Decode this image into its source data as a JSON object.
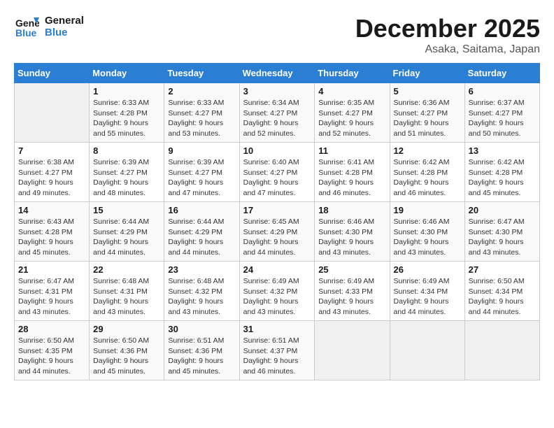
{
  "header": {
    "logo_line1": "General",
    "logo_line2": "Blue",
    "month_title": "December 2025",
    "location": "Asaka, Saitama, Japan"
  },
  "weekdays": [
    "Sunday",
    "Monday",
    "Tuesday",
    "Wednesday",
    "Thursday",
    "Friday",
    "Saturday"
  ],
  "weeks": [
    [
      {
        "day": "",
        "info": ""
      },
      {
        "day": "1",
        "info": "Sunrise: 6:33 AM\nSunset: 4:28 PM\nDaylight: 9 hours\nand 55 minutes."
      },
      {
        "day": "2",
        "info": "Sunrise: 6:33 AM\nSunset: 4:27 PM\nDaylight: 9 hours\nand 53 minutes."
      },
      {
        "day": "3",
        "info": "Sunrise: 6:34 AM\nSunset: 4:27 PM\nDaylight: 9 hours\nand 52 minutes."
      },
      {
        "day": "4",
        "info": "Sunrise: 6:35 AM\nSunset: 4:27 PM\nDaylight: 9 hours\nand 52 minutes."
      },
      {
        "day": "5",
        "info": "Sunrise: 6:36 AM\nSunset: 4:27 PM\nDaylight: 9 hours\nand 51 minutes."
      },
      {
        "day": "6",
        "info": "Sunrise: 6:37 AM\nSunset: 4:27 PM\nDaylight: 9 hours\nand 50 minutes."
      }
    ],
    [
      {
        "day": "7",
        "info": "Sunrise: 6:38 AM\nSunset: 4:27 PM\nDaylight: 9 hours\nand 49 minutes."
      },
      {
        "day": "8",
        "info": "Sunrise: 6:39 AM\nSunset: 4:27 PM\nDaylight: 9 hours\nand 48 minutes."
      },
      {
        "day": "9",
        "info": "Sunrise: 6:39 AM\nSunset: 4:27 PM\nDaylight: 9 hours\nand 47 minutes."
      },
      {
        "day": "10",
        "info": "Sunrise: 6:40 AM\nSunset: 4:27 PM\nDaylight: 9 hours\nand 47 minutes."
      },
      {
        "day": "11",
        "info": "Sunrise: 6:41 AM\nSunset: 4:28 PM\nDaylight: 9 hours\nand 46 minutes."
      },
      {
        "day": "12",
        "info": "Sunrise: 6:42 AM\nSunset: 4:28 PM\nDaylight: 9 hours\nand 46 minutes."
      },
      {
        "day": "13",
        "info": "Sunrise: 6:42 AM\nSunset: 4:28 PM\nDaylight: 9 hours\nand 45 minutes."
      }
    ],
    [
      {
        "day": "14",
        "info": "Sunrise: 6:43 AM\nSunset: 4:28 PM\nDaylight: 9 hours\nand 45 minutes."
      },
      {
        "day": "15",
        "info": "Sunrise: 6:44 AM\nSunset: 4:29 PM\nDaylight: 9 hours\nand 44 minutes."
      },
      {
        "day": "16",
        "info": "Sunrise: 6:44 AM\nSunset: 4:29 PM\nDaylight: 9 hours\nand 44 minutes."
      },
      {
        "day": "17",
        "info": "Sunrise: 6:45 AM\nSunset: 4:29 PM\nDaylight: 9 hours\nand 44 minutes."
      },
      {
        "day": "18",
        "info": "Sunrise: 6:46 AM\nSunset: 4:30 PM\nDaylight: 9 hours\nand 43 minutes."
      },
      {
        "day": "19",
        "info": "Sunrise: 6:46 AM\nSunset: 4:30 PM\nDaylight: 9 hours\nand 43 minutes."
      },
      {
        "day": "20",
        "info": "Sunrise: 6:47 AM\nSunset: 4:30 PM\nDaylight: 9 hours\nand 43 minutes."
      }
    ],
    [
      {
        "day": "21",
        "info": "Sunrise: 6:47 AM\nSunset: 4:31 PM\nDaylight: 9 hours\nand 43 minutes."
      },
      {
        "day": "22",
        "info": "Sunrise: 6:48 AM\nSunset: 4:31 PM\nDaylight: 9 hours\nand 43 minutes."
      },
      {
        "day": "23",
        "info": "Sunrise: 6:48 AM\nSunset: 4:32 PM\nDaylight: 9 hours\nand 43 minutes."
      },
      {
        "day": "24",
        "info": "Sunrise: 6:49 AM\nSunset: 4:32 PM\nDaylight: 9 hours\nand 43 minutes."
      },
      {
        "day": "25",
        "info": "Sunrise: 6:49 AM\nSunset: 4:33 PM\nDaylight: 9 hours\nand 43 minutes."
      },
      {
        "day": "26",
        "info": "Sunrise: 6:49 AM\nSunset: 4:34 PM\nDaylight: 9 hours\nand 44 minutes."
      },
      {
        "day": "27",
        "info": "Sunrise: 6:50 AM\nSunset: 4:34 PM\nDaylight: 9 hours\nand 44 minutes."
      }
    ],
    [
      {
        "day": "28",
        "info": "Sunrise: 6:50 AM\nSunset: 4:35 PM\nDaylight: 9 hours\nand 44 minutes."
      },
      {
        "day": "29",
        "info": "Sunrise: 6:50 AM\nSunset: 4:36 PM\nDaylight: 9 hours\nand 45 minutes."
      },
      {
        "day": "30",
        "info": "Sunrise: 6:51 AM\nSunset: 4:36 PM\nDaylight: 9 hours\nand 45 minutes."
      },
      {
        "day": "31",
        "info": "Sunrise: 6:51 AM\nSunset: 4:37 PM\nDaylight: 9 hours\nand 46 minutes."
      },
      {
        "day": "",
        "info": ""
      },
      {
        "day": "",
        "info": ""
      },
      {
        "day": "",
        "info": ""
      }
    ]
  ]
}
